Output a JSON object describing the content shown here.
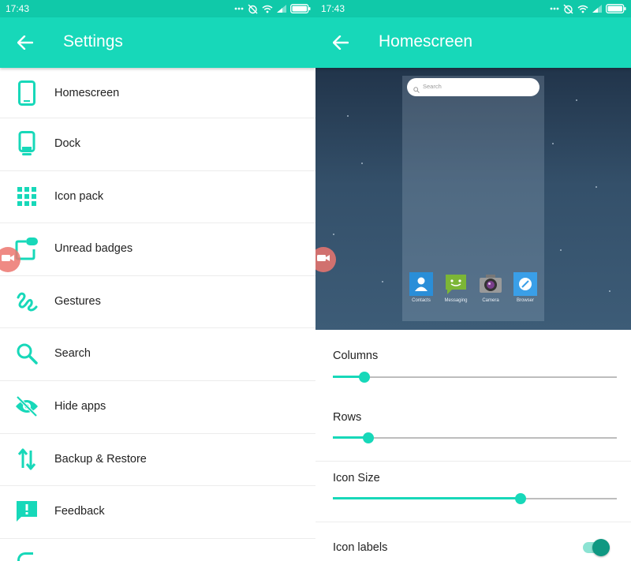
{
  "colors": {
    "accent": "#17d8b9",
    "statusbar": "#10c9a9",
    "toggle_on": "#0f9882"
  },
  "left": {
    "status": {
      "time": "17:43",
      "battery_icon": "battery-icon",
      "wifi_icon": "wifi-icon",
      "signal_icon": "signal-icon",
      "alarm_icon": "alarm-off-icon"
    },
    "appbar": {
      "title": "Settings",
      "back_icon": "arrow-back-icon"
    },
    "items": [
      {
        "label": "Homescreen",
        "icon": "phone-icon"
      },
      {
        "label": "Dock",
        "icon": "dock-icon"
      },
      {
        "label": "Icon pack",
        "icon": "grid-icon"
      },
      {
        "label": "Unread badges",
        "icon": "badge-icon"
      },
      {
        "label": "Gestures",
        "icon": "gesture-icon"
      },
      {
        "label": "Search",
        "icon": "search-icon"
      },
      {
        "label": "Hide apps",
        "icon": "eye-off-icon"
      },
      {
        "label": "Backup & Restore",
        "icon": "swap-vertical-icon"
      },
      {
        "label": "Feedback",
        "icon": "feedback-icon"
      }
    ]
  },
  "right": {
    "status": {
      "time": "17:43"
    },
    "appbar": {
      "title": "Homescreen",
      "back_icon": "arrow-back-icon"
    },
    "preview": {
      "search_placeholder": "Search",
      "dock_apps": [
        {
          "label": "Contacts",
          "icon": "contacts-icon"
        },
        {
          "label": "Messaging",
          "icon": "messaging-icon"
        },
        {
          "label": "Camera",
          "icon": "camera-icon"
        },
        {
          "label": "Browser",
          "icon": "browser-icon"
        }
      ]
    },
    "settings": {
      "columns": {
        "label": "Columns",
        "value_fraction": 0.11
      },
      "rows": {
        "label": "Rows",
        "value_fraction": 0.125
      },
      "icon_size": {
        "label": "Icon Size",
        "value_fraction": 0.66
      },
      "icon_labels": {
        "label": "Icon labels",
        "enabled": true
      }
    }
  }
}
